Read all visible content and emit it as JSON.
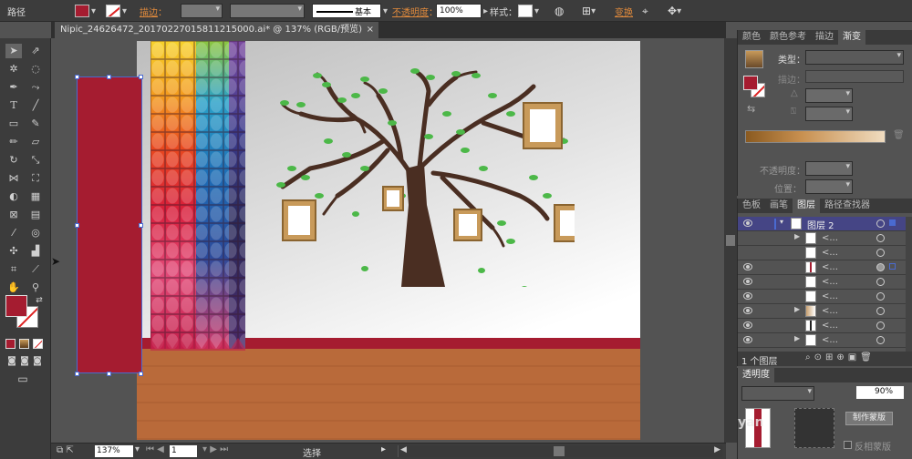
{
  "controlbar": {
    "path_label": "路径",
    "stroke_label": "描边",
    "stroke_weight_field": "",
    "brush_label": "基本",
    "opacity_label": "不透明度",
    "opacity_value": "100%",
    "style_label": "样式",
    "transform_label": "变换",
    "fill_color": "#a51c30"
  },
  "document": {
    "tab_title": "Nipic_24626472_20170227015811215000.ai* @ 137% (RGB/预览)",
    "close": "×"
  },
  "toolbar": {
    "fill_color": "#a51c30"
  },
  "canvas": {
    "floor_color": "#b96a3a",
    "trim_color": "#a51c30",
    "rect_color": "#a51c30"
  },
  "status": {
    "zoom": "137%",
    "page": "1",
    "mode": "选择"
  },
  "gradient_panel": {
    "tabs": [
      "颜色",
      "颜色参考",
      "描边",
      "渐变"
    ],
    "active_tab": "渐变",
    "type_label": "类型：",
    "stroke_label": "描边：",
    "opacity_label": "不透明度：",
    "position_label": "位置："
  },
  "layers_panel": {
    "tabs": [
      "色板",
      "画笔",
      "图层",
      "路径查找器"
    ],
    "active_tab": "图层",
    "layer_name": "图层 2",
    "row_text": "<...",
    "footer": "1 个图层"
  },
  "transparency_panel": {
    "title": "透明度",
    "opacity_value": "90%",
    "make_mask": "制作蒙版",
    "invert_mask": "反相蒙版",
    "watermark": "yan"
  }
}
